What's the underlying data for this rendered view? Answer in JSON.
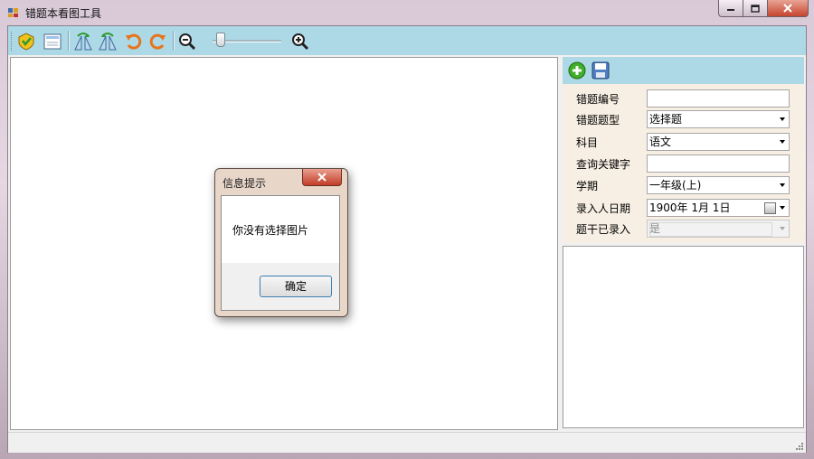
{
  "window": {
    "title": "错题本看图工具",
    "controls": {
      "minimize_icon": "minimize-icon",
      "maximize_icon": "maximize-icon",
      "close_icon": "close-icon"
    }
  },
  "toolbar": {
    "buttons": [
      {
        "name": "import-icon"
      },
      {
        "name": "fit-window-icon"
      },
      {
        "name": "flip-horizontal-icon"
      },
      {
        "name": "flip-vertical-icon"
      },
      {
        "name": "rotate-left-icon"
      },
      {
        "name": "rotate-right-icon"
      },
      {
        "name": "zoom-out-icon"
      },
      {
        "name": "zoom-in-icon"
      }
    ],
    "zoom_level": 0.05
  },
  "right_toolbar": {
    "buttons": [
      {
        "name": "add-icon"
      },
      {
        "name": "save-icon"
      }
    ]
  },
  "form": {
    "fields": [
      {
        "label": "错题编号",
        "value": "",
        "type": "text"
      },
      {
        "label": "错题题型",
        "value": "选择题",
        "type": "select"
      },
      {
        "label": "科目",
        "value": "语文",
        "type": "select"
      },
      {
        "label": "查询关键字",
        "value": "",
        "type": "text"
      },
      {
        "label": "学期",
        "value": "一年级(上)",
        "type": "select"
      },
      {
        "label": "录入人日期",
        "value": "1900年 1月 1日",
        "type": "date"
      },
      {
        "label": "题干已录入",
        "value": "是",
        "type": "select-disabled"
      }
    ]
  },
  "dialog": {
    "title": "信息提示",
    "message": "你没有选择图片",
    "ok_label": "确定"
  },
  "colors": {
    "toolbar": "#add8e6",
    "form_bg": "#f7efe4",
    "close_red": "#c5452e"
  }
}
